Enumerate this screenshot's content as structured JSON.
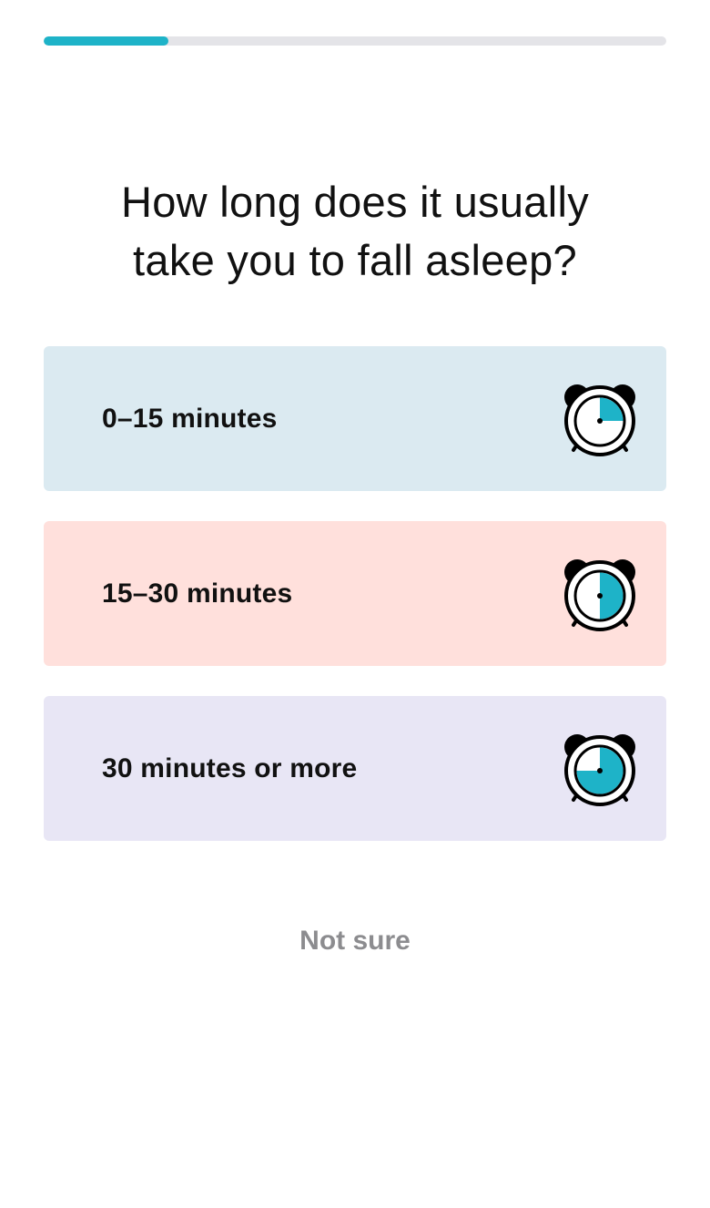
{
  "progress": {
    "fraction": 0.2
  },
  "question": {
    "line1": "How long does it usually",
    "line2": "take you to fall asleep?"
  },
  "options": [
    {
      "label": "0–15 minutes",
      "background": "#dbeaf1",
      "clock_fill_fraction": 0.25,
      "icon": "alarm-clock-quarter-icon"
    },
    {
      "label": "15–30 minutes",
      "background": "#ffe0dc",
      "clock_fill_fraction": 0.5,
      "icon": "alarm-clock-half-icon"
    },
    {
      "label": "30 minutes or more",
      "background": "#e8e6f5",
      "clock_fill_fraction": 0.75,
      "icon": "alarm-clock-three-quarter-icon"
    }
  ],
  "not_sure": {
    "label": "Not sure"
  },
  "colors": {
    "accent": "#1eb3c8",
    "track": "#e4e4e8",
    "muted_text": "#8c8c8f"
  }
}
